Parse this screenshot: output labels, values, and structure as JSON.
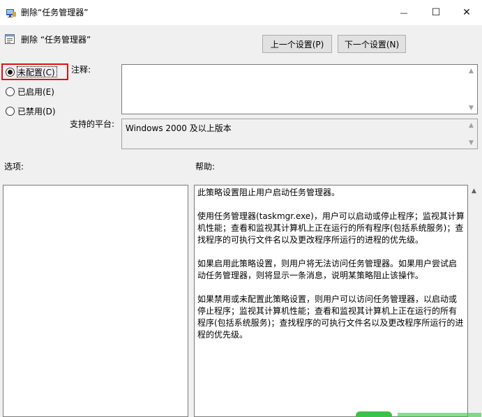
{
  "window": {
    "title": "删除“任务管理器”",
    "minimize_glyph": "—",
    "maximize_glyph": "☐",
    "close_glyph": "✕"
  },
  "header": {
    "policy_title": "删除 “任务管理器”",
    "prev_button": "上一个设置(P)",
    "next_button": "下一个设置(N)"
  },
  "radios": {
    "not_configured": "未配置(C)",
    "enabled": "已启用(E)",
    "disabled": "已禁用(D)",
    "selected": "not_configured"
  },
  "labels": {
    "comment": "注释:",
    "supported_platforms": "支持的平台:",
    "options": "选项:",
    "help": "帮助:"
  },
  "fields": {
    "comment_value": "",
    "platform_value": "Windows 2000 及以上版本"
  },
  "help_text": [
    "此策略设置阻止用户启动任务管理器。",
    "使用任务管理器(taskmgr.exe)，用户可以启动或停止程序；监视其计算机性能；查看和监视其计算机上正在运行的所有程序(包括系统服务)；查找程序的可执行文件名以及更改程序所运行的进程的优先级。",
    "如果启用此策略设置，则用户将无法访问任务管理器。如果用户尝试启动任务管理器，则将显示一条消息，说明某策略阻止该操作。",
    "如果禁用或未配置此策略设置，则用户可以访问任务管理器，以启动或停止程序；监视其计算机性能；查看和监视其计算机上正在运行的所有程序(包括系统服务)；查找程序的可执行文件名以及更改程序所运行的进程的优先级。"
  ],
  "colors": {
    "focus_outline": "#e01010",
    "window_bg": "#f0f0f0"
  }
}
